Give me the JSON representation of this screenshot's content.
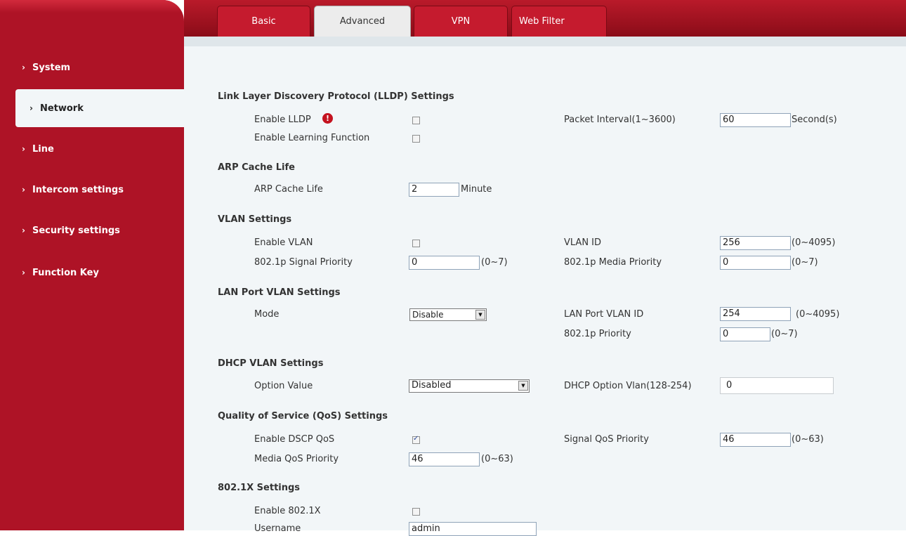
{
  "sidebar": {
    "items": [
      {
        "label": "System"
      },
      {
        "label": "Network"
      },
      {
        "label": "Line"
      },
      {
        "label": "Intercom settings"
      },
      {
        "label": "Security settings"
      },
      {
        "label": "Function Key"
      }
    ],
    "chevron": "›"
  },
  "tabs": [
    {
      "label": "Basic"
    },
    {
      "label": "Advanced"
    },
    {
      "label": "VPN"
    },
    {
      "label": "Web Filter"
    }
  ],
  "lldp": {
    "title": "Link Layer Discovery Protocol (LLDP) Settings",
    "enable_label": "Enable LLDP",
    "enable_checked": false,
    "learning_label": "Enable Learning Function",
    "learning_checked": false,
    "interval_label": "Packet Interval(1~3600)",
    "interval_value": "60",
    "interval_unit": "Second(s)"
  },
  "arp": {
    "title": "ARP Cache Life",
    "label": "ARP Cache Life",
    "value": "2",
    "unit": "Minute"
  },
  "vlan": {
    "title": "VLAN Settings",
    "enable_label": "Enable VLAN",
    "enable_checked": false,
    "id_label": "VLAN ID",
    "id_value": "256",
    "id_range": "(0~4095)",
    "signal_label": "802.1p Signal Priority",
    "signal_value": "0",
    "signal_range": "(0~7)",
    "media_label": "802.1p Media Priority",
    "media_value": "0",
    "media_range": "(0~7)"
  },
  "lan_vlan": {
    "title": "LAN Port VLAN Settings",
    "mode_label": "Mode",
    "mode_value": "Disable",
    "id_label": "LAN Port VLAN ID",
    "id_value": "254",
    "id_range": "(0~4095)",
    "priority_label": "802.1p Priority",
    "priority_value": "0",
    "priority_range": "(0~7)"
  },
  "dhcp_vlan": {
    "title": "DHCP VLAN Settings",
    "option_label": "Option Value",
    "option_value": "Disabled",
    "vlan_label": "DHCP Option Vlan(128-254)",
    "vlan_value": "0"
  },
  "qos": {
    "title": "Quality of Service (QoS) Settings",
    "dscp_label": "Enable DSCP QoS",
    "dscp_checked": true,
    "signal_label": "Signal QoS Priority",
    "signal_value": "46",
    "signal_range": "(0~63)",
    "media_label": "Media QoS Priority",
    "media_value": "46",
    "media_range": "(0~63)"
  },
  "dot1x": {
    "title": "802.1X Settings",
    "enable_label": "Enable 802.1X",
    "enable_checked": false,
    "username_label": "Username",
    "username_value": "admin"
  },
  "colors": {
    "brand_red": "#ae1326",
    "content_bg": "#f2f6f8"
  },
  "icons": {
    "warning": "warning-icon",
    "dropdown": "chevron-down-icon"
  }
}
